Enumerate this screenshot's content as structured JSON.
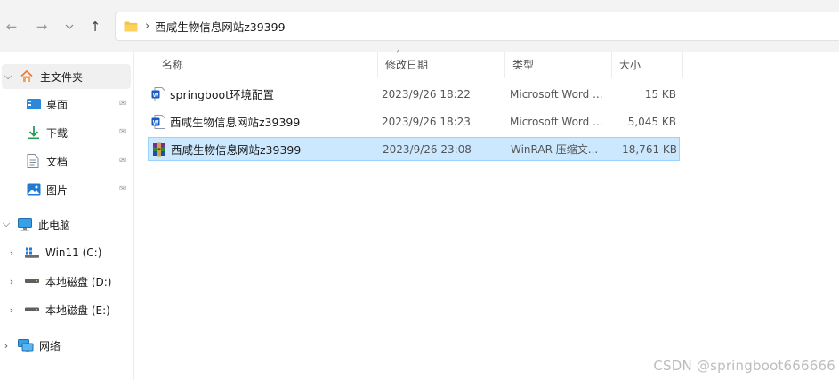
{
  "address": {
    "path": "西咸生物信息网站z39399"
  },
  "headers": {
    "name": "名称",
    "date": "修改日期",
    "type": "类型",
    "size": "大小"
  },
  "nav": {
    "home": "主文件夹",
    "desktop": "桌面",
    "downloads": "下载",
    "documents": "文档",
    "pictures": "图片",
    "this_pc": "此电脑",
    "drive_c": "Win11 (C:)",
    "drive_d": "本地磁盘 (D:)",
    "drive_e": "本地磁盘 (E:)",
    "network": "网络"
  },
  "files": [
    {
      "name": "springboot环境配置",
      "date": "2023/9/26 18:22",
      "type": "Microsoft Word ...",
      "size": "15 KB",
      "icon": "word-doc-icon"
    },
    {
      "name": "西咸生物信息网站z39399",
      "date": "2023/9/26 18:23",
      "type": "Microsoft Word ...",
      "size": "5,045 KB",
      "icon": "word-doc-icon"
    },
    {
      "name": "西咸生物信息网站z39399",
      "date": "2023/9/26 23:08",
      "type": "WinRAR 压缩文...",
      "size": "18,761 KB",
      "icon": "winrar-archive-icon",
      "selected": true
    }
  ],
  "watermark": "CSDN @springboot666666",
  "colors": {
    "selection_bg": "#cce8ff",
    "selection_border": "#99d1ff",
    "folder": "#f5c542",
    "accent": "#0067c0"
  }
}
